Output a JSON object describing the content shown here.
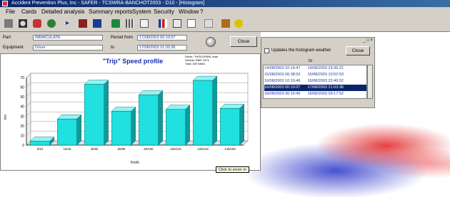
{
  "app": {
    "title": "Accident Prevention Plus, Inc - SAFER - TCSWRA-BANCHOT2003 - D10 - [Histogram]"
  },
  "menu": [
    "File",
    "Cards",
    "Detailed analysis",
    "Summary reports",
    "System",
    "Security",
    "Window",
    "?"
  ],
  "toolbar": {
    "icons": [
      "print-icon",
      "find-icon",
      "car-icon",
      "person-icon",
      "arrow-right-icon",
      "next-icon",
      "last-icon",
      "truck-icon",
      "grid-icon",
      "report-icon",
      "chart-icon",
      "table-icon",
      "calendar-icon",
      "document-icon",
      "tools-icon",
      "help-icon"
    ]
  },
  "form": {
    "part_label": "Part",
    "part_value": "IMMACULATE",
    "equipment_label": "Equipment",
    "equipment_value": "Driver",
    "period_from_label": "Period from",
    "period_from_value": "17/08/2003  00:10:07",
    "to_label": "to",
    "to_value": "17/08/2003  21:03:36",
    "close_label": "Close"
  },
  "side_panel": {
    "update_label": "Updates the histogram weather",
    "close_label": "Close",
    "col_header": "to",
    "rows": [
      {
        "from": "14/08/2003  10:14:47",
        "to": "14/08/2003  23:36:21",
        "selected": false
      },
      {
        "from": "15/08/2003  06:38:52",
        "to": "15/08/2003  10:52:53",
        "selected": false
      },
      {
        "from": "16/08/2003  10:10:46",
        "to": "16/08/2003  22:46:52",
        "selected": false
      },
      {
        "from": "16/08/2003  00:10:07",
        "to": "17/08/2003  21:03:36",
        "selected": true
      },
      {
        "from": "18/08/2003  00:10:45",
        "to": "18/08/2003  09:17:52",
        "selected": false
      }
    ]
  },
  "chart_data": {
    "type": "bar",
    "title": "\"Trip\" Speed profile",
    "legend_lines": [
      "Driver: THOUVENIN Jean",
      "Vehicle: BMP 1974",
      "Total: 329 Miles"
    ],
    "categories": [
      "0/10",
      "10/40",
      "40/60",
      "60/80",
      "80/100",
      "100/120",
      "120/140",
      "140/160"
    ],
    "values": [
      4,
      27,
      63,
      35,
      52,
      37,
      67,
      38
    ],
    "ylim": [
      0,
      70
    ],
    "yticks": [
      0,
      10,
      20,
      30,
      40,
      50,
      60,
      70
    ],
    "xlabel": "Km/h",
    "ylabel": "km",
    "bar_color": "#20e0e0",
    "grid": true
  },
  "tooltip": "Click to zoom in"
}
